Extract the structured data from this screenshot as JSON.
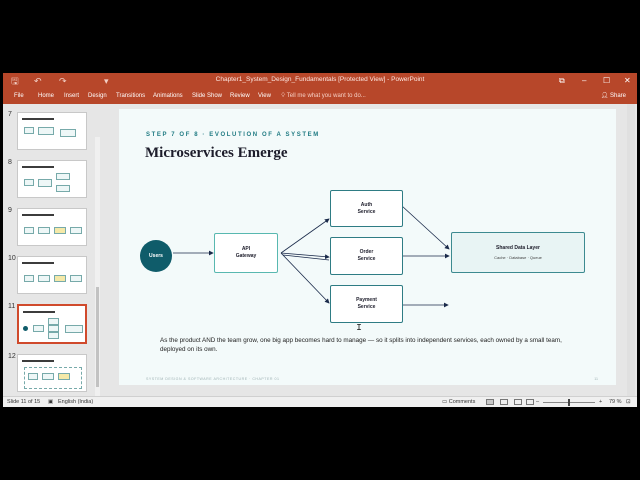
{
  "window": {
    "title": "Chapter1_System_Design_Fundamentals [Protected View] - PowerPoint",
    "quick_access": {
      "save": "🖫",
      "undo": "↶",
      "redo": "↷",
      "customize": "▾"
    },
    "controls": {
      "restore": "⧉",
      "minimize": "–",
      "maximize": "☐",
      "close": "✕"
    }
  },
  "menu": {
    "tabs": [
      "File",
      "Home",
      "Insert",
      "Design",
      "Transitions",
      "Animations",
      "Slide Show",
      "Review",
      "View"
    ],
    "tell_me": "Tell me what you want to do...",
    "share": "Share"
  },
  "thumbnails": [
    {
      "num": "7",
      "title": "Move to Microservices",
      "selected": false
    },
    {
      "num": "8",
      "title": "Distributed services",
      "selected": false
    },
    {
      "num": "9",
      "title": "Horizontal scaling",
      "selected": false
    },
    {
      "num": "10",
      "title": "Service Architecture",
      "selected": false
    },
    {
      "num": "11",
      "title": "Microservices Emerge",
      "selected": true
    },
    {
      "num": "12",
      "title": "Everything services",
      "selected": false
    }
  ],
  "slide": {
    "step": "STEP 7 OF 8 · EVOLUTION OF A SYSTEM",
    "title": "Microservices Emerge",
    "nodes": {
      "users": "Users",
      "api": [
        "API",
        "Gateway"
      ],
      "auth": [
        "Auth",
        "Service"
      ],
      "order": [
        "Order",
        "Service"
      ],
      "payment": [
        "Payment",
        "Service"
      ],
      "shared_title": "Shared Data Layer",
      "shared_sub": "Cache · Database · Queue"
    },
    "description": "As the product AND the team grow, one big app becomes hard to manage — so it splits into independent services, each owned by a small team, deployed on its own.",
    "footer": "SYSTEM DESIGN & SOFTWARE ARCHITECTURE · CHAPTER 01",
    "page_number": "11"
  },
  "status": {
    "slide": "Slide 11 of 15",
    "language": "English (India)",
    "comments": "Comments",
    "zoom_minus": "–",
    "zoom_plus": "+",
    "zoom": "79 %"
  },
  "colors": {
    "accent": "#b7472a",
    "teal": "#1f7a82",
    "users_fill": "#0f5c6a"
  }
}
